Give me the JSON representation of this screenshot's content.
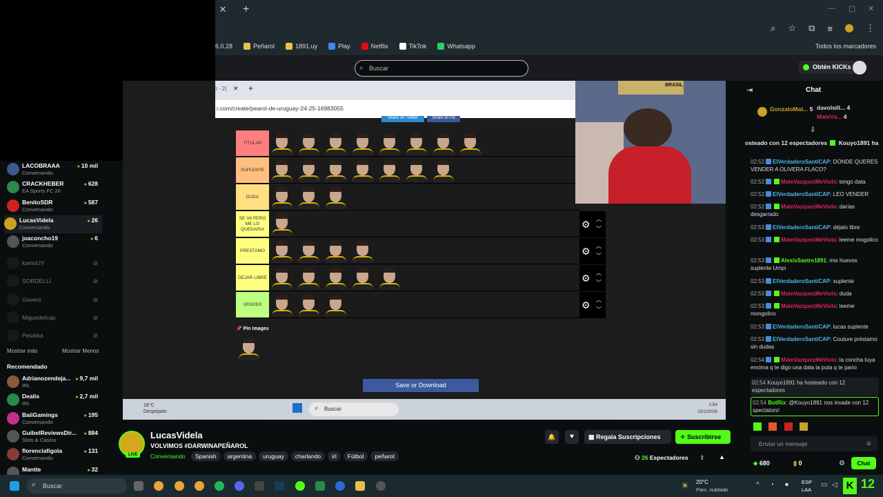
{
  "browser": {
    "bookmarks": [
      {
        "label": "6.0.28",
        "icon": "bookmark-icon",
        "color": "#888888"
      },
      {
        "label": "Peñarol",
        "icon": "folder-icon",
        "color": "#e8c04a"
      },
      {
        "label": "1891.uy",
        "icon": "trophy-icon",
        "color": "#e8c04a"
      },
      {
        "label": "Play",
        "icon": "play-icon",
        "color": "#4285f4"
      },
      {
        "label": "Netflix",
        "icon": "netflix-icon",
        "color": "#e50914"
      },
      {
        "label": "TikTok",
        "icon": "tiktok-icon",
        "color": "#ffffff"
      },
      {
        "label": "Whatsapp",
        "icon": "whatsapp-icon",
        "color": "#25d366"
      }
    ],
    "all_bookmarks": "Todos los marcadores"
  },
  "header": {
    "search_placeholder": "Buscar",
    "kicks_button": "Obtén KICKs"
  },
  "sidebar": {
    "following": [
      {
        "name": "LACOBRAAA",
        "sub": "Conversando",
        "viewers": "10 mil",
        "color": "#3a5a8a"
      },
      {
        "name": "CRACKHEBER",
        "sub": "EA Sports FC 26",
        "viewers": "628",
        "color": "#2a8a4a"
      },
      {
        "name": "BenitoSDR",
        "sub": "Conversando",
        "viewers": "587",
        "color": "#c22"
      },
      {
        "name": "LucasVidela",
        "sub": "Conversando",
        "viewers": "26",
        "color": "#c9a227"
      },
      {
        "name": "joaconcho19",
        "sub": "Conversando",
        "viewers": "6",
        "color": "#555"
      }
    ],
    "offline": [
      "kamoUY",
      "SORDELLI",
      "Gavero",
      "Miguedelcap",
      "Petakka"
    ],
    "show_more": "Mostrar más",
    "show_less": "Mostrar Menos",
    "recommended_title": "Recomendado",
    "recommended": [
      {
        "name": "Adrianozendeja...",
        "sub": "IRL",
        "viewers": "9,7 mil",
        "color": "#8a5a3a"
      },
      {
        "name": "Dealis",
        "sub": "IRL",
        "viewers": "2,7 mil",
        "color": "#2a8a4a"
      },
      {
        "name": "BaiiGamings",
        "sub": "Conversando",
        "viewers": "195",
        "color": "#c2308a"
      },
      {
        "name": "GuibelReviewsDir...",
        "sub": "Slots & Casino",
        "viewers": "884",
        "color": "#555"
      },
      {
        "name": "florenciafigola",
        "sub": "Conversando",
        "viewers": "131",
        "color": "#8a3a3a"
      },
      {
        "name": "Mantte",
        "sub": "",
        "viewers": "32",
        "color": "#555"
      }
    ]
  },
  "stream_view": {
    "inner_url": "r.com/create/pearol-de-uruguay-24-25-16983055",
    "share_twitter": "Share on Twitter",
    "share_fb": "Share on FB",
    "tiers": [
      {
        "label": "TITULAR",
        "color": "#ff7f7f",
        "players": 8
      },
      {
        "label": "SUPLENTE",
        "color": "#ffbf7f",
        "players": 7
      },
      {
        "label": "DUDA",
        "color": "#ffdf7f",
        "players": 3
      },
      {
        "label": "SE VA PERO ME LO QUEDARIA",
        "color": "#ffff7f",
        "players": 1
      },
      {
        "label": "PRESTAMO",
        "color": "#ffff7f",
        "players": 4
      },
      {
        "label": "DEJAR LIBRE",
        "color": "#ffff7f",
        "players": 5
      },
      {
        "label": "VENDER",
        "color": "#bfff7f",
        "players": 3
      }
    ],
    "pin_images": "Pin Images",
    "save_button": "Save or Download",
    "weather": "18°C",
    "weather_sub": "Despejado",
    "taskbar_search": "Buscar",
    "clock": "2:54",
    "date": "15/2/2026",
    "poster_text": "BRASIL"
  },
  "streamer": {
    "name": "LucasVidela",
    "title": "VOLVIMOS #DARWINAPEÑAROL",
    "category": "Conversando",
    "tags": [
      "Spanish",
      "argentina",
      "uruguay",
      "charlando",
      "irl",
      "Fútbol",
      "peñarol"
    ],
    "live_badge": "LIVE",
    "gift_subs": "Regala Suscripciones",
    "subscribe": "Suscribirse",
    "viewers": "26",
    "viewers_label": "Espectadores"
  },
  "chat": {
    "title": "Chat",
    "top_gifters": [
      {
        "name": "GonzaloMat...",
        "count": "5"
      },
      {
        "name": "davolsill...",
        "count": "4"
      },
      {
        "name": "MateVa...",
        "count": "4"
      }
    ],
    "host_banner": "osteado con 12 espectadores",
    "host_user": "Kouyo1891 ha",
    "messages": [
      {
        "time": "02:52",
        "user": "ElVerdaderoSantiCAP",
        "text": ": DONDE QUERES VENDER A OLIVERA FLACO?",
        "style": "u1"
      },
      {
        "time": "02:52",
        "user": "MateVazquezMeViolo",
        "text": ": tengo data",
        "style": "u2"
      },
      {
        "time": "02:52",
        "user": "ElVerdaderoSantiCAP",
        "text": ": LEO VENDER",
        "style": "u1"
      },
      {
        "time": "02:52",
        "user": "MateVazquezMeViolo",
        "text": ": darías desgarrado",
        "style": "u2"
      },
      {
        "time": "02:53",
        "user": "ElVerdaderoSantiCAP",
        "text": ": déjalo libre",
        "style": "u1"
      },
      {
        "time": "02:53",
        "user": "MateVazquezMeViolo",
        "text": ": leeme mogolico",
        "style": "u2"
      },
      {
        "time": "02:53",
        "user": "AlexisSastre1891",
        "text": ": mis huevos suplente Umpi",
        "style": "u3"
      },
      {
        "time": "02:53",
        "user": "ElVerdaderoSantiCAP",
        "text": ": suplente",
        "style": "u1"
      },
      {
        "time": "02:53",
        "user": "MateVazquezMeViolo",
        "text": ": duda",
        "style": "u2"
      },
      {
        "time": "02:53",
        "user": "MateVazquezMeViolo",
        "text": ": leeme mongolico",
        "style": "u2"
      },
      {
        "time": "02:53",
        "user": "ElVerdaderoSantiCAP",
        "text": ": lucas suplente",
        "style": "u1"
      },
      {
        "time": "02:53",
        "user": "ElVerdaderoSantiCAP",
        "text": ": Couture préstamo sin dudas",
        "style": "u1"
      },
      {
        "time": "02:54",
        "user": "MateVazquezMeViolo",
        "text": ": la concha tuya encima q te digo una data la puta q te pario",
        "style": "u2"
      }
    ],
    "host_msg_time": "02:54",
    "host_msg": "Kouyo1891 ha hosteado con 12 espectadores",
    "bot_time": "02:54",
    "bot_user": "BotRix",
    "bot_text": ": @Kouyo1891 nos invade con 12 spectators!",
    "input_placeholder": "Enviar un mensaje",
    "points": "680",
    "zero": "0",
    "send": "Chat"
  },
  "taskbar": {
    "search": "Buscar",
    "weather_temp": "20°C",
    "weather_desc": "Parc. nublado",
    "lang": "ESP",
    "lang2": "LAA",
    "kick_badge": "12"
  }
}
